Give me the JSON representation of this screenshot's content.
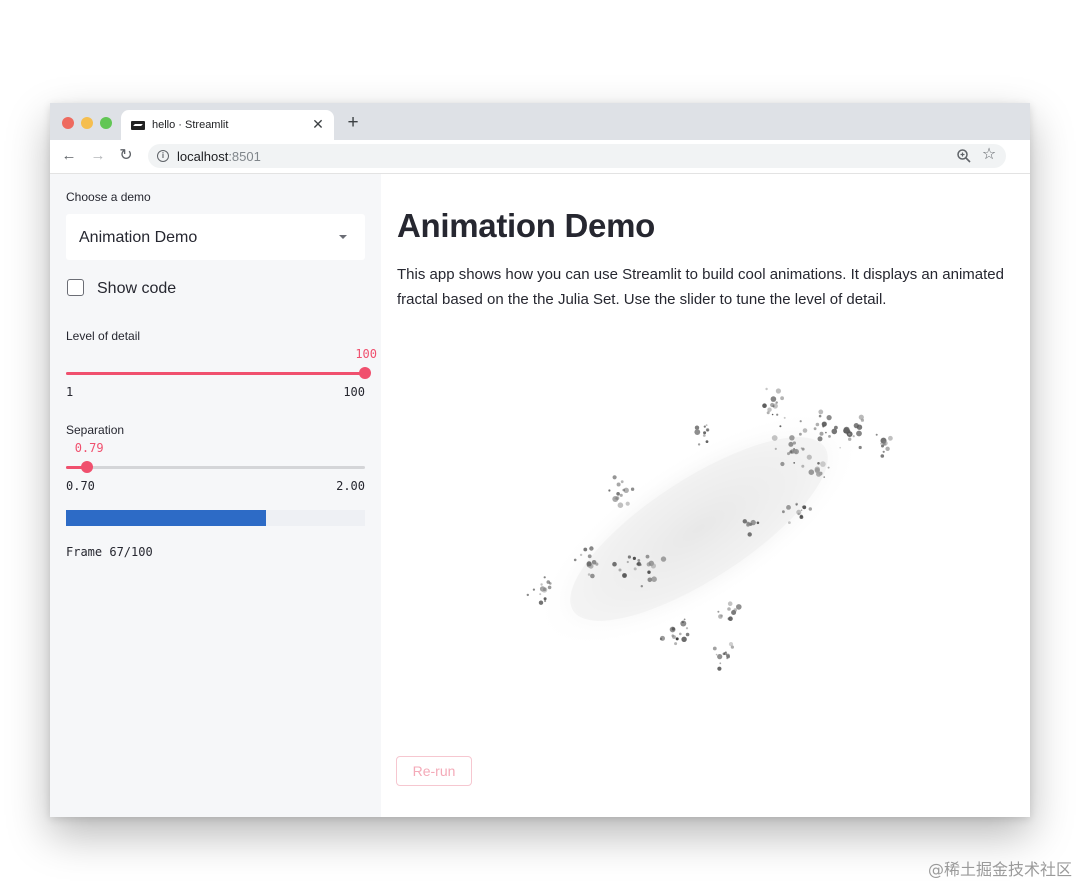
{
  "browser": {
    "tab_title": "hello · Streamlit",
    "url_host": "localhost",
    "url_port": ":8501"
  },
  "sidebar": {
    "demo_select_label": "Choose a demo",
    "demo_select_value": "Animation Demo",
    "show_code_label": "Show code",
    "show_code_checked": false,
    "detail_slider": {
      "label": "Level of detail",
      "value_text": "100",
      "min_text": "1",
      "max_text": "100",
      "value": 100,
      "min": 1,
      "max": 100
    },
    "separation_slider": {
      "label": "Separation",
      "value_text": "0.79",
      "min_text": "0.70",
      "max_text": "2.00",
      "value": 0.79,
      "min": 0.7,
      "max": 2.0
    },
    "progress": 0.67,
    "frame_text": "Frame 67/100"
  },
  "main": {
    "title": "Animation Demo",
    "description": "This app shows how you can use Streamlit to build cool animations. It displays an animated fractal based on the the Julia Set. Use the slider to tune the level of detail.",
    "rerun_label": "Re-run"
  },
  "colors": {
    "accent": "#f0506e",
    "progress": "#2d6bc6",
    "sidebar_bg": "#f6f7f9",
    "text": "#262730"
  },
  "watermark": "@稀土掘金技术社区"
}
